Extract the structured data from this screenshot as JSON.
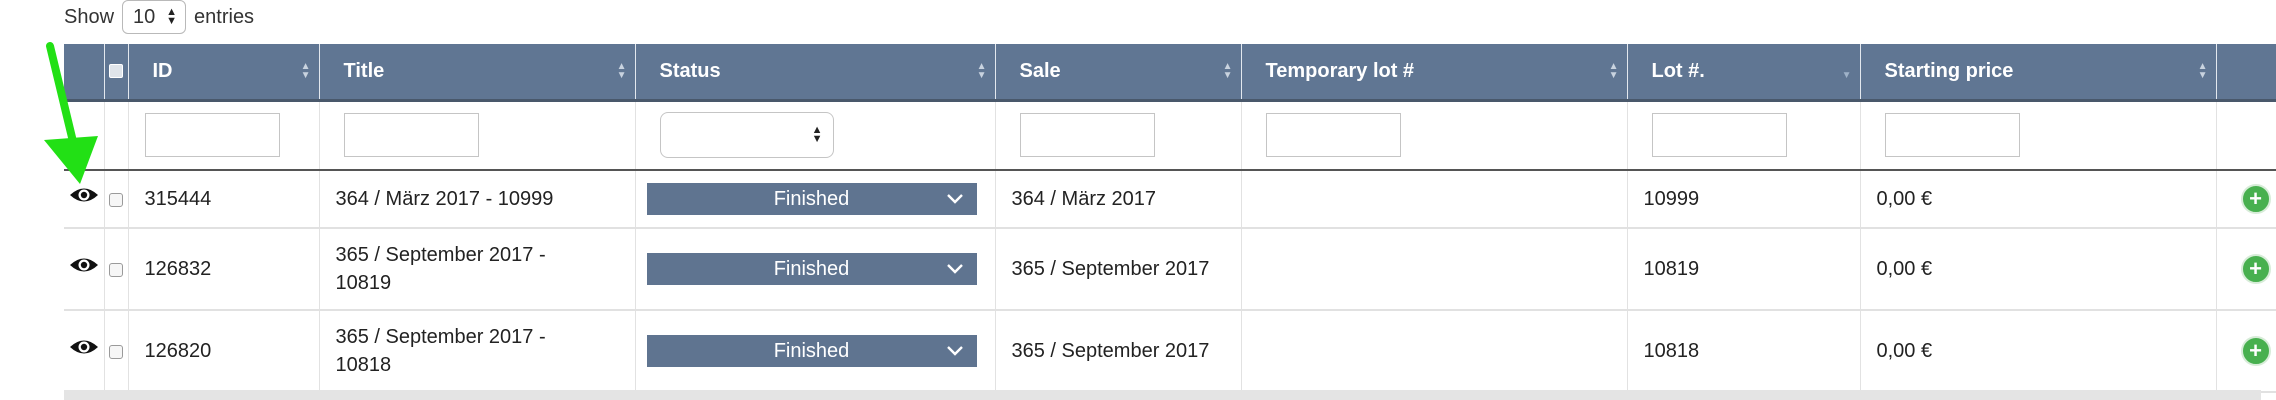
{
  "length_control": {
    "prefix": "Show",
    "value": "10",
    "suffix": "entries"
  },
  "columns": [
    {
      "key": "id",
      "label": "ID"
    },
    {
      "key": "title",
      "label": "Title"
    },
    {
      "key": "status",
      "label": "Status"
    },
    {
      "key": "sale",
      "label": "Sale"
    },
    {
      "key": "temp_lot",
      "label": "Temporary lot #"
    },
    {
      "key": "lot",
      "label": "Lot #."
    },
    {
      "key": "starting_price",
      "label": "Starting price"
    }
  ],
  "rows": [
    {
      "id": "315444",
      "title": "364 / März 2017 - 10999",
      "status": "Finished",
      "sale": "364 / März 2017",
      "temp_lot": "",
      "lot": "10999",
      "starting_price": "0,00 €"
    },
    {
      "id": "126832",
      "title": "365 / September 2017 - 10819",
      "status": "Finished",
      "sale": "365 / September 2017",
      "temp_lot": "",
      "lot": "10819",
      "starting_price": "0,00 €"
    },
    {
      "id": "126820",
      "title": "365 / September 2017 - 10818",
      "status": "Finished",
      "sale": "365 / September 2017",
      "temp_lot": "",
      "lot": "10818",
      "starting_price": "0,00 €"
    }
  ],
  "icons": {
    "view": "eye-icon",
    "add": "plus-circle-icon",
    "status_toggle": "chevron-down-icon",
    "sort": "sort-arrows-icon",
    "annotation": "arrow-icon"
  },
  "colors": {
    "header_bg": "#607693",
    "status_bg": "#5f7490",
    "add_button": "#48b04f",
    "annotation_arrow": "#22e015"
  }
}
